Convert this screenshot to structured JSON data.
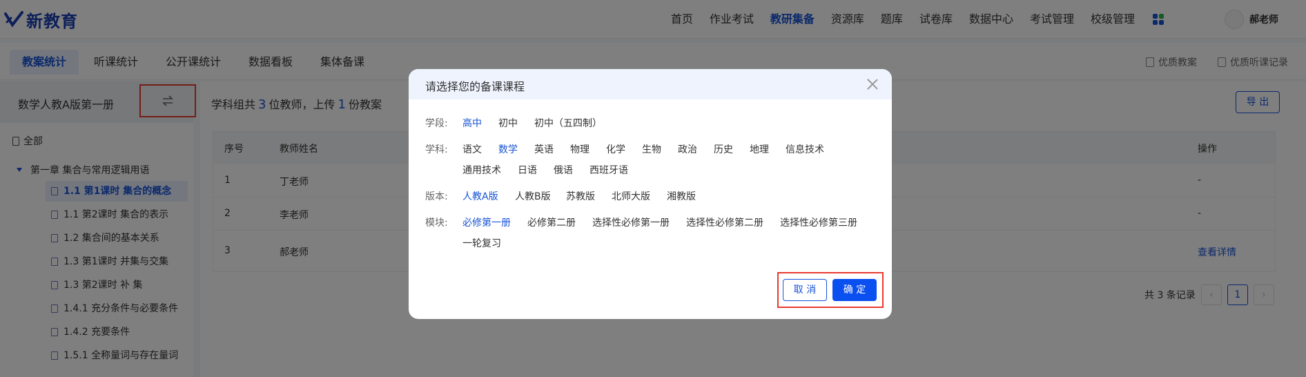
{
  "brand": {
    "name": "新教育",
    "accent": "#1753d6"
  },
  "nav": {
    "items": [
      "首页",
      "作业考试",
      "教研集备",
      "资源库",
      "题库",
      "试卷库",
      "数据中心",
      "考试管理",
      "校级管理"
    ],
    "active": "教研集备"
  },
  "user": {
    "name": "郝老师"
  },
  "subtabs": {
    "items": [
      "教案统计",
      "听课统计",
      "公开课统计",
      "数据看板",
      "集体备课"
    ],
    "active": "教案统计",
    "right_links": [
      "优质教案",
      "优质听课记录"
    ]
  },
  "sidebar": {
    "course": "数学人教A版第一册",
    "all_label": "全部",
    "chapter": "第一章    集合与常用逻辑用语",
    "lessons": [
      "1.1    第1课时    集合的概念",
      "1.1    第2课时    集合的表示",
      "1.2    集合间的基本关系",
      "1.3    第1课时    并集与交集",
      "1.3    第2课时    补    集",
      "1.4.1    充分条件与必要条件",
      "1.4.2    充要条件",
      "1.5.1    全称量词与存在量词"
    ]
  },
  "summary": {
    "prefix": "学科组共",
    "teachers": "3",
    "mid": "位教师，上传",
    "plans": "1",
    "suffix": "份教案"
  },
  "export_label": "导 出",
  "table": {
    "headers": {
      "index": "序号",
      "name": "教师姓名",
      "action": "操作"
    },
    "rows": [
      {
        "index": "1",
        "name": "丁老师",
        "action": "-"
      },
      {
        "index": "2",
        "name": "李老师",
        "action": "-"
      },
      {
        "index": "3",
        "name": "郝老师",
        "action": "查看详情"
      }
    ]
  },
  "pagination": {
    "total_text": "共 3 条记录",
    "current": "1",
    "prev": "‹",
    "next": "›"
  },
  "dialog": {
    "title": "请选择您的备课课程",
    "stage": {
      "label": "学段:",
      "options": [
        "高中",
        "初中",
        "初中（五四制）"
      ],
      "selected": "高中"
    },
    "subject": {
      "label": "学科:",
      "options": [
        "语文",
        "数学",
        "英语",
        "物理",
        "化学",
        "生物",
        "政治",
        "历史",
        "地理",
        "信息技术",
        "通用技术",
        "日语",
        "俄语",
        "西班牙语"
      ],
      "selected": "数学"
    },
    "edition": {
      "label": "版本:",
      "options": [
        "人教A版",
        "人教B版",
        "苏教版",
        "北师大版",
        "湘教版"
      ],
      "selected": "人教A版"
    },
    "module": {
      "label": "模块:",
      "options": [
        "必修第一册",
        "必修第二册",
        "选择性必修第一册",
        "选择性必修第二册",
        "选择性必修第三册",
        "一轮复习"
      ],
      "selected": "必修第一册"
    },
    "cancel_label": "取 消",
    "ok_label": "确 定"
  }
}
